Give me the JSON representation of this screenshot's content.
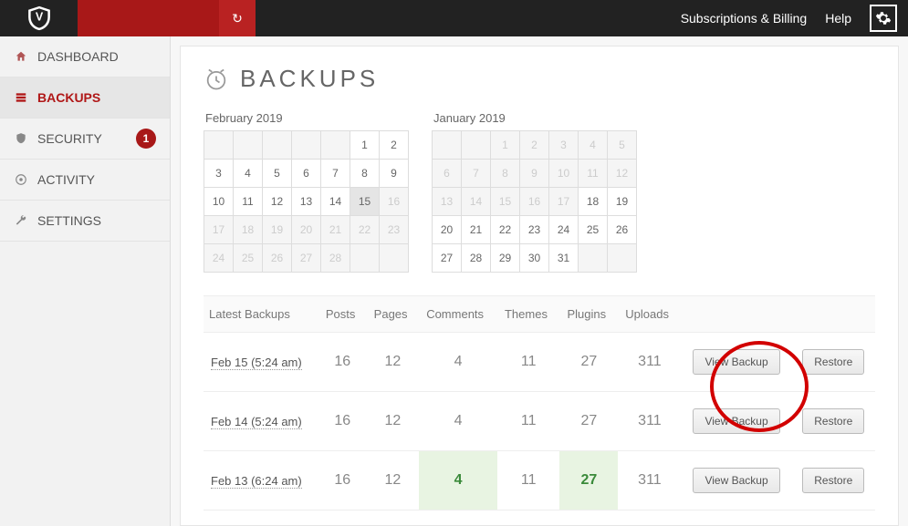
{
  "header": {
    "subscriptions": "Subscriptions & Billing",
    "help": "Help"
  },
  "sidebar": {
    "items": [
      {
        "label": "DASHBOARD"
      },
      {
        "label": "BACKUPS"
      },
      {
        "label": "SECURITY",
        "badge": "1"
      },
      {
        "label": "ACTIVITY"
      },
      {
        "label": "SETTINGS"
      }
    ]
  },
  "page": {
    "title": "BACKUPS"
  },
  "calendars": [
    {
      "title": "February 2019",
      "weeks": [
        [
          "",
          "",
          "",
          "",
          "",
          "1",
          "2"
        ],
        [
          "3",
          "4",
          "5",
          "6",
          "7",
          "8",
          "9"
        ],
        [
          "10",
          "11",
          "12",
          "13",
          "14",
          "15",
          "16"
        ],
        [
          "17",
          "18",
          "19",
          "20",
          "21",
          "22",
          "23"
        ],
        [
          "24",
          "25",
          "26",
          "27",
          "28",
          "",
          ""
        ]
      ]
    },
    {
      "title": "January 2019",
      "weeks": [
        [
          "",
          "",
          "1",
          "2",
          "3",
          "4",
          "5"
        ],
        [
          "6",
          "7",
          "8",
          "9",
          "10",
          "11",
          "12"
        ],
        [
          "13",
          "14",
          "15",
          "16",
          "17",
          "18",
          "19"
        ],
        [
          "20",
          "21",
          "22",
          "23",
          "24",
          "25",
          "26"
        ],
        [
          "27",
          "28",
          "29",
          "30",
          "31",
          "",
          ""
        ]
      ]
    }
  ],
  "table": {
    "headers": {
      "latest": "Latest Backups",
      "posts": "Posts",
      "pages": "Pages",
      "comments": "Comments",
      "themes": "Themes",
      "plugins": "Plugins",
      "uploads": "Uploads"
    },
    "rows": [
      {
        "date": "Feb 15 (5:24 am)",
        "posts": "16",
        "pages": "12",
        "comments": "4",
        "themes": "11",
        "plugins": "27",
        "uploads": "311",
        "hl": []
      },
      {
        "date": "Feb 14 (5:24 am)",
        "posts": "16",
        "pages": "12",
        "comments": "4",
        "themes": "11",
        "plugins": "27",
        "uploads": "311",
        "hl": []
      },
      {
        "date": "Feb 13 (6:24 am)",
        "posts": "16",
        "pages": "12",
        "comments": "4",
        "themes": "11",
        "plugins": "27",
        "uploads": "311",
        "hl": [
          "comments",
          "plugins"
        ]
      }
    ],
    "view_label": "View Backup",
    "restore_label": "Restore"
  }
}
